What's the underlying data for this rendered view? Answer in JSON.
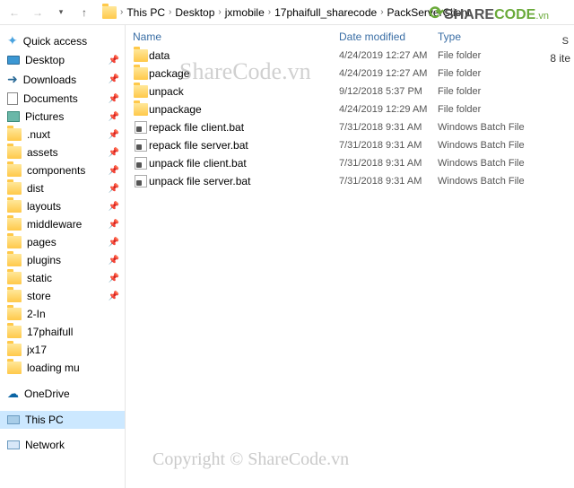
{
  "breadcrumb": [
    "This PC",
    "Desktop",
    "jxmobile",
    "17phaifull_sharecode",
    "PackServerClient"
  ],
  "columns": {
    "name": "Name",
    "date": "Date modified",
    "type": "Type"
  },
  "rightcol": "S",
  "itemcount": "8 ite",
  "sidebar": {
    "quick": "Quick access",
    "desktop": "Desktop",
    "downloads": "Downloads",
    "documents": "Documents",
    "pictures": "Pictures",
    "folders": [
      ".nuxt",
      "assets",
      "components",
      "dist",
      "layouts",
      "middleware",
      "pages",
      "plugins",
      "static",
      "store",
      "2-In",
      "17phaifull",
      "jx17",
      "loading mu"
    ],
    "onedrive": "OneDrive",
    "thispc": "This PC",
    "network": "Network"
  },
  "files": [
    {
      "icon": "folder",
      "name": "data",
      "date": "4/24/2019 12:27 AM",
      "type": "File folder"
    },
    {
      "icon": "folder",
      "name": "package",
      "date": "4/24/2019 12:27 AM",
      "type": "File folder"
    },
    {
      "icon": "folder",
      "name": "unpack",
      "date": "9/12/2018 5:37 PM",
      "type": "File folder"
    },
    {
      "icon": "folder",
      "name": "unpackage",
      "date": "4/24/2019 12:29 AM",
      "type": "File folder"
    },
    {
      "icon": "bat",
      "name": "repack file client.bat",
      "date": "7/31/2018 9:31 AM",
      "type": "Windows Batch File"
    },
    {
      "icon": "bat",
      "name": "repack file server.bat",
      "date": "7/31/2018 9:31 AM",
      "type": "Windows Batch File"
    },
    {
      "icon": "bat",
      "name": "unpack file client.bat",
      "date": "7/31/2018 9:31 AM",
      "type": "Windows Batch File"
    },
    {
      "icon": "bat",
      "name": "unpack file server.bat",
      "date": "7/31/2018 9:31 AM",
      "type": "Windows Batch File"
    }
  ],
  "watermark1": "ShareCode.vn",
  "watermark2": "Copyright © ShareCode.vn",
  "logo": {
    "a": "SHARE",
    "b": "CODE",
    "c": ".vn"
  }
}
